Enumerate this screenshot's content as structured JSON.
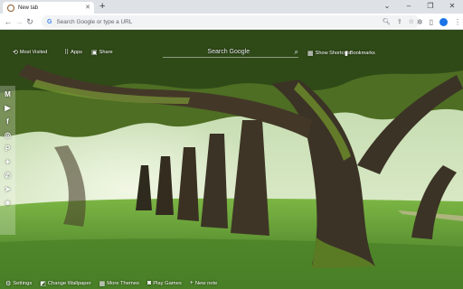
{
  "browser": {
    "tab_title": "New tab",
    "new_tab_symbol": "+",
    "window_controls": [
      "⌄",
      "–",
      "❐",
      "✕"
    ],
    "omnibox_placeholder": "Search Google or type a URL",
    "omnibox_g": "G"
  },
  "newtab": {
    "most_visited": "Most Visited",
    "apps": "Apps",
    "share": "Share",
    "search_placeholder": "Search Google",
    "show_shortcuts": "Show Shortcuts",
    "bookmarks": "Bookmarks"
  },
  "social_icons": [
    "gmail-icon",
    "youtube-icon",
    "facebook-icon",
    "instagram-icon",
    "pinterest-icon",
    "twitter-icon",
    "whatsapp-icon",
    "telegram-icon",
    "reddit-icon"
  ],
  "footer": {
    "settings": "Settings",
    "change_wallpaper": "Change Wallpaper",
    "more_themes": "More Themes",
    "play_games": "Play Games",
    "new_note": "New note"
  },
  "colors": {
    "tabstrip": "#dee1e6",
    "omnibox": "#f1f3f4",
    "sky": "#cfe8c0",
    "grass": "#4f8a2c",
    "bark": "#3b3325",
    "moss": "#4e6e23"
  }
}
